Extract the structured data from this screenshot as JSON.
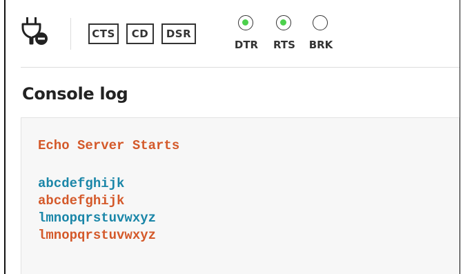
{
  "toolbar": {
    "connection_icon": "plug-disconnected-icon",
    "signals": [
      {
        "label": "CTS"
      },
      {
        "label": "CD"
      },
      {
        "label": "DSR"
      }
    ],
    "leds": [
      {
        "label": "DTR",
        "state": "on",
        "color": "#4cd14c"
      },
      {
        "label": "RTS",
        "state": "on",
        "color": "#4cd14c"
      },
      {
        "label": "BRK",
        "state": "off",
        "color": ""
      }
    ]
  },
  "console": {
    "title": "Console log",
    "lines": [
      {
        "text": "Echo Server Starts",
        "color": "#d4592a"
      },
      {
        "text": "",
        "color": ""
      },
      {
        "text": "abcdefghijk",
        "color": "#1a86a8"
      },
      {
        "text": "abcdefghijk",
        "color": "#d4592a"
      },
      {
        "text": "lmnopqrstuvwxyz",
        "color": "#1a86a8"
      },
      {
        "text": "lmnopqrstuvwxyz",
        "color": "#d4592a"
      }
    ]
  }
}
